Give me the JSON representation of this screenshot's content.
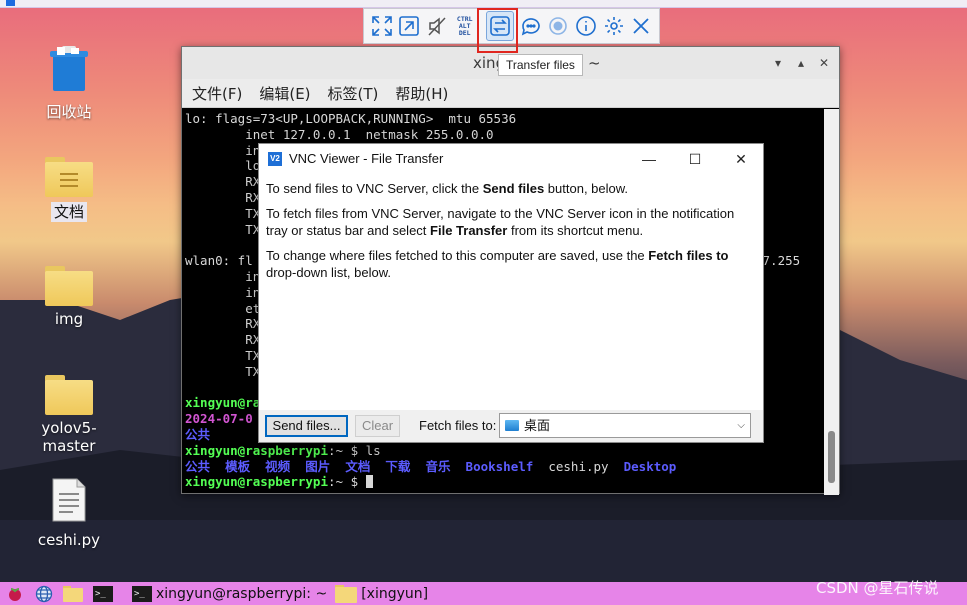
{
  "desktop": {
    "icons": [
      {
        "label": "回收站",
        "icon": "trash-icon"
      },
      {
        "label": "文档",
        "icon": "folder-icon"
      },
      {
        "label": "img",
        "icon": "folder-icon"
      },
      {
        "label": "yolov5-master",
        "icon": "folder-icon"
      },
      {
        "label": "ceshi.py",
        "icon": "file-icon"
      }
    ]
  },
  "vnc_toolbar": {
    "buttons": [
      "fullscreen-icon",
      "scale-icon",
      "mute-icon",
      "ctrl-alt-del-icon",
      "transfer-files-icon",
      "chat-icon",
      "record-icon",
      "info-icon",
      "settings-icon",
      "close-icon"
    ],
    "ctrl_alt_del_text": [
      "CTRL",
      "ALT",
      "DEL"
    ],
    "tooltip": "Transfer files"
  },
  "terminal": {
    "title": "xingyun@",
    "title_suffix": "~",
    "menu": [
      "文件(F)",
      "编辑(E)",
      "标签(T)",
      "帮助(H)"
    ],
    "lines": {
      "l1": "lo: flags=73<UP,LOOPBACK,RUNNING>  mtu 65536",
      "l2": "        inet 127.0.0.1  netmask 255.0.0.0",
      "l3": "        in",
      "l4": "        lo",
      "l5": "        RX",
      "l6": "        RX",
      "l7": "        TX",
      "l8": "        TX",
      "l9": "wlan0: fl",
      "l9_tail": "87.255",
      "l10": "        in",
      "l11": "        in",
      "l12": "        et",
      "l13": "        RX",
      "l14": "        RX",
      "l15": "        TX",
      "l16": "        TX",
      "p1_user": "xingyun@ra",
      "p2_date": "2024-07-0",
      "p2_tail": "op",
      "p3": "公共",
      "prompt_user": "xingyun@raspberrypi",
      "prompt_sym": ":~ $ ",
      "cmd_ls": "ls",
      "ls_dirs": [
        "公共",
        "模板",
        "视频",
        "图片",
        "文档",
        "下载",
        "音乐",
        "Bookshelf"
      ],
      "ls_file": "ceshi.py",
      "ls_last": "Desktop"
    }
  },
  "dialog": {
    "title": "VNC Viewer - File Transfer",
    "logo": "V2",
    "p1_pre": "To send files to VNC Server, click the ",
    "p1_bold": "Send files",
    "p1_post": " button, below.",
    "p2_pre": "To fetch files from VNC Server, navigate to the VNC Server icon in the notification tray or status bar and select ",
    "p2_bold": "File Transfer",
    "p2_post": " from its shortcut menu.",
    "p3_pre": "To change where files fetched to this computer are saved, use the ",
    "p3_bold": "Fetch files to",
    "p3_post": " drop-down list, below.",
    "send_button": "Send files...",
    "clear_button": "Clear",
    "fetch_label": "Fetch files to:",
    "fetch_value": "桌面"
  },
  "taskbar": {
    "terminal_task": "xingyun@raspberrypi: ~",
    "folder_task": "[xingyun]"
  },
  "watermark": "CSDN @星石传说",
  "colors": {
    "highlight": "#e0261f",
    "taskbar": "#e684e8",
    "accent": "#1f6fcf"
  }
}
